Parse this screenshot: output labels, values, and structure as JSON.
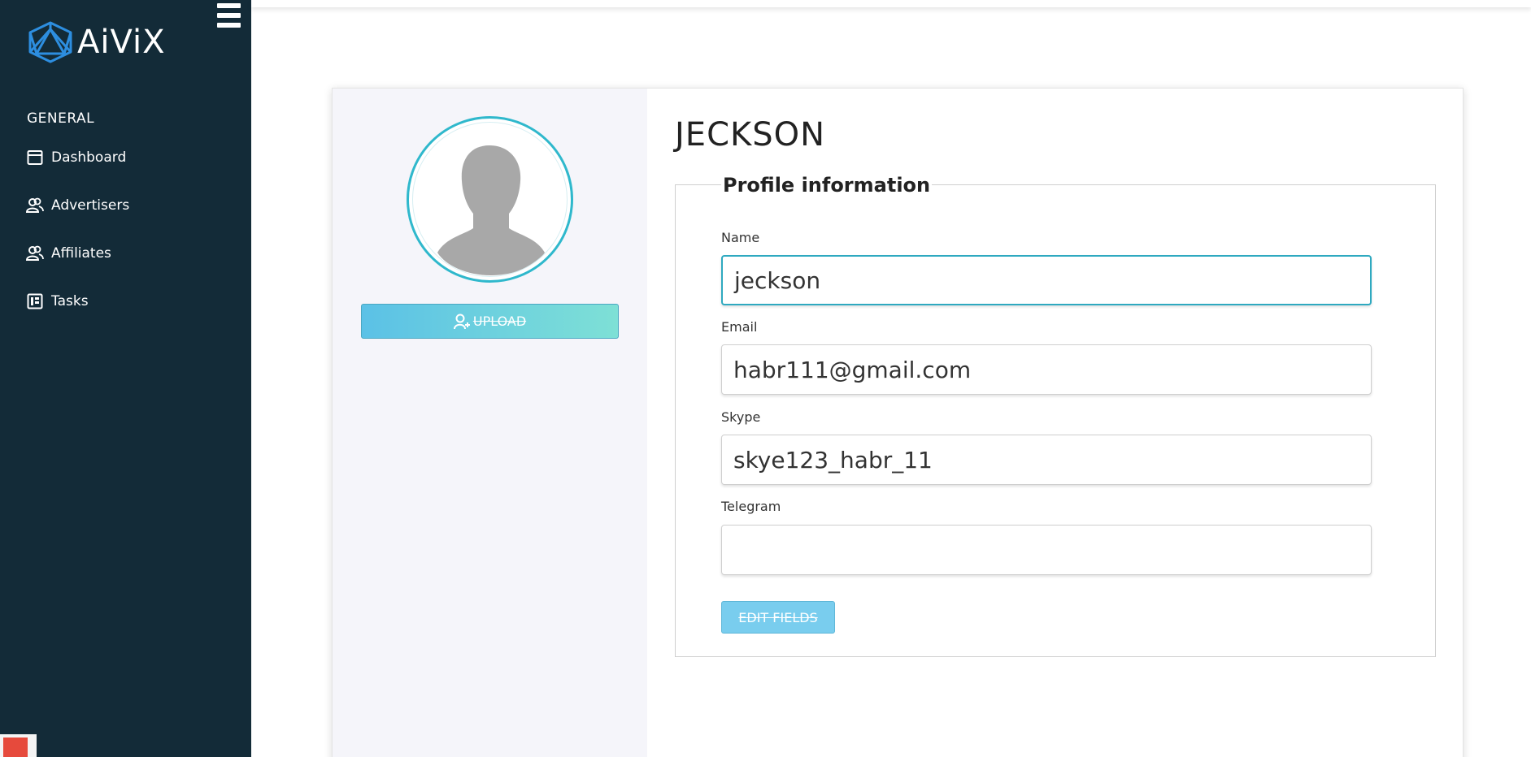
{
  "brand": {
    "name": "AiViX",
    "accent": "#2d8ee0"
  },
  "sidebar": {
    "section_title": "GENERAL",
    "items": [
      {
        "label": "Dashboard",
        "icon": "calendar-icon"
      },
      {
        "label": "Advertisers",
        "icon": "users-icon"
      },
      {
        "label": "Affiliates",
        "icon": "users-icon"
      },
      {
        "label": "Tasks",
        "icon": "tasks-icon"
      }
    ]
  },
  "profile": {
    "title": "JECKSON",
    "upload_label": "UPLOAD",
    "section_title": "Profile information",
    "fields": [
      {
        "label": "Name",
        "value": "jeckson"
      },
      {
        "label": "Email",
        "value": "habr111@gmail.com"
      },
      {
        "label": "Skype",
        "value": "skye123_habr_11"
      },
      {
        "label": "Telegram",
        "value": ""
      }
    ],
    "edit_label": "EDIT FIELDS"
  },
  "colors": {
    "sidebar_bg": "#132b38",
    "ring": "#2fb8cc",
    "button_blue": "#79cdee"
  }
}
